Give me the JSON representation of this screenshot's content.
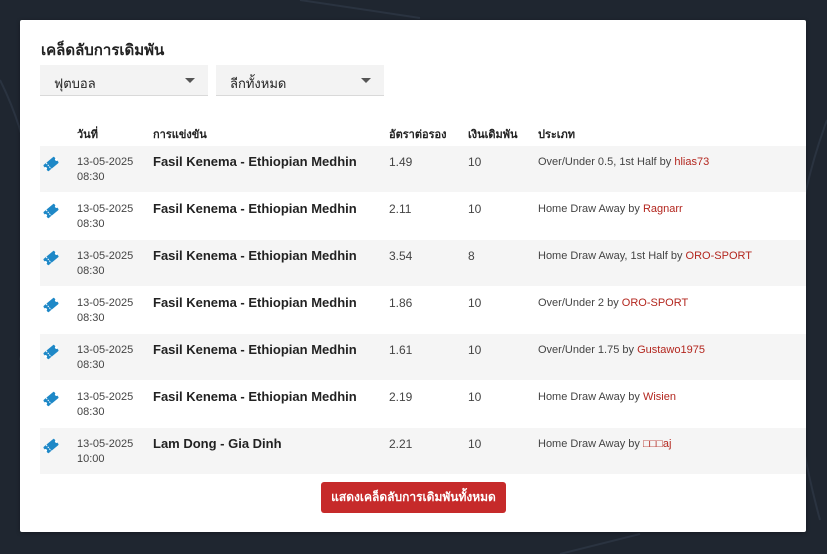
{
  "title": "เคล็ดลับการเดิมพัน",
  "filters": {
    "sport": "ฟุตบอล",
    "league": "ลีกทั้งหมด"
  },
  "columns": {
    "date": "วันที่",
    "match": "การแข่งขัน",
    "odds": "อัตราต่อรอง",
    "stake": "เงินเดิมพัน",
    "type": "ประเภท"
  },
  "tips": [
    {
      "date": "13-05-2025",
      "time": "08:30",
      "match": "Fasil Kenema - Ethiopian Medhin",
      "odds": "1.49",
      "stake": "10",
      "type": "Over/Under 0.5, 1st Half by",
      "user": "hlias73"
    },
    {
      "date": "13-05-2025",
      "time": "08:30",
      "match": "Fasil Kenema - Ethiopian Medhin",
      "odds": "2.11",
      "stake": "10",
      "type": "Home Draw Away by",
      "user": "Ragnarr"
    },
    {
      "date": "13-05-2025",
      "time": "08:30",
      "match": "Fasil Kenema - Ethiopian Medhin",
      "odds": "3.54",
      "stake": "8",
      "type": "Home Draw Away, 1st Half by",
      "user": "ORO-SPORT"
    },
    {
      "date": "13-05-2025",
      "time": "08:30",
      "match": "Fasil Kenema - Ethiopian Medhin",
      "odds": "1.86",
      "stake": "10",
      "type": "Over/Under 2 by",
      "user": "ORO-SPORT"
    },
    {
      "date": "13-05-2025",
      "time": "08:30",
      "match": "Fasil Kenema - Ethiopian Medhin",
      "odds": "1.61",
      "stake": "10",
      "type": "Over/Under 1.75 by",
      "user": "Gustawo1975"
    },
    {
      "date": "13-05-2025",
      "time": "08:30",
      "match": "Fasil Kenema - Ethiopian Medhin",
      "odds": "2.19",
      "stake": "10",
      "type": "Home Draw Away by",
      "user": "Wisien"
    },
    {
      "date": "13-05-2025",
      "time": "10:00",
      "match": "Lam Dong - Gia Dinh",
      "odds": "2.21",
      "stake": "10",
      "type": "Home Draw Away by",
      "user": "□□□aj"
    }
  ],
  "show_all_button": "แสดงเคล็ดลับการเดิมพันทั้งหมด",
  "colors": {
    "accent": "#c62a2a",
    "ticket_icon": "#1e88c7",
    "user_link": "#b3261e"
  },
  "icons": {
    "tip": "ticket-icon",
    "dropdown": "chevron-down-icon"
  }
}
